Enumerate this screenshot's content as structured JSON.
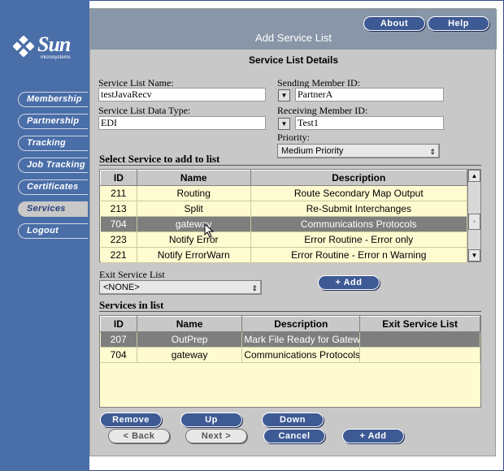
{
  "brand": {
    "name": "Sun",
    "sub": "microsystems"
  },
  "nav": {
    "items": [
      {
        "label": "Membership"
      },
      {
        "label": "Partnership"
      },
      {
        "label": "Tracking"
      },
      {
        "label": "Job Tracking"
      },
      {
        "label": "Certificates"
      },
      {
        "label": "Services",
        "active": true
      },
      {
        "label": "Logout"
      }
    ]
  },
  "header": {
    "title": "Add Service List",
    "about": "About",
    "help": "Help"
  },
  "details": {
    "title": "Service List Details",
    "service_list_name_label": "Service List Name:",
    "service_list_name_value": "testJavaRecv",
    "data_type_label": "Service List Data Type:",
    "data_type_value": "EDI",
    "sending_member_label": "Sending Member ID:",
    "sending_member_value": "PartnerA",
    "receiving_member_label": "Receiving Member ID:",
    "receiving_member_value": "Test1",
    "priority_label": "Priority:",
    "priority_value": "Medium Priority"
  },
  "select_service": {
    "title": "Select Service to add to list",
    "columns": [
      "ID",
      "Name",
      "Description"
    ],
    "rows": [
      {
        "id": "211",
        "name": "Routing",
        "desc": "Route Secondary Map Output"
      },
      {
        "id": "213",
        "name": "Split",
        "desc": "Re-Submit Interchanges"
      },
      {
        "id": "704",
        "name": "gateway",
        "desc": "Communications Protocols",
        "selected": true
      },
      {
        "id": "223",
        "name": "Notify Error",
        "desc": "Error Routine - Error only"
      },
      {
        "id": "221",
        "name": "Notify ErrorWarn",
        "desc": "Error Routine - Error n Warning"
      }
    ]
  },
  "exit_list": {
    "label": "Exit Service List",
    "value": "<NONE>",
    "add": "+ Add"
  },
  "services_in_list": {
    "title": "Services in list",
    "columns": [
      "ID",
      "Name",
      "Description",
      "Exit Service List"
    ],
    "rows": [
      {
        "id": "207",
        "name": "OutPrep",
        "desc": "Mark File Ready for Gatewa",
        "exit": "",
        "selected": true
      },
      {
        "id": "704",
        "name": "gateway",
        "desc": "Communications Protocols",
        "exit": ""
      }
    ]
  },
  "actions": {
    "remove": "Remove",
    "up": "Up",
    "down": "Down",
    "back": "< Back",
    "next": "Next >",
    "cancel": "Cancel",
    "add": "+ Add"
  },
  "colors": {
    "nav_bg": "#4a6ea8",
    "panel_bg": "#c8c8c8",
    "header_bg": "#8896a8",
    "button_blue": "#3d5a94",
    "table_bg": "#fffbd0",
    "selected_row": "#7e7e7e"
  }
}
